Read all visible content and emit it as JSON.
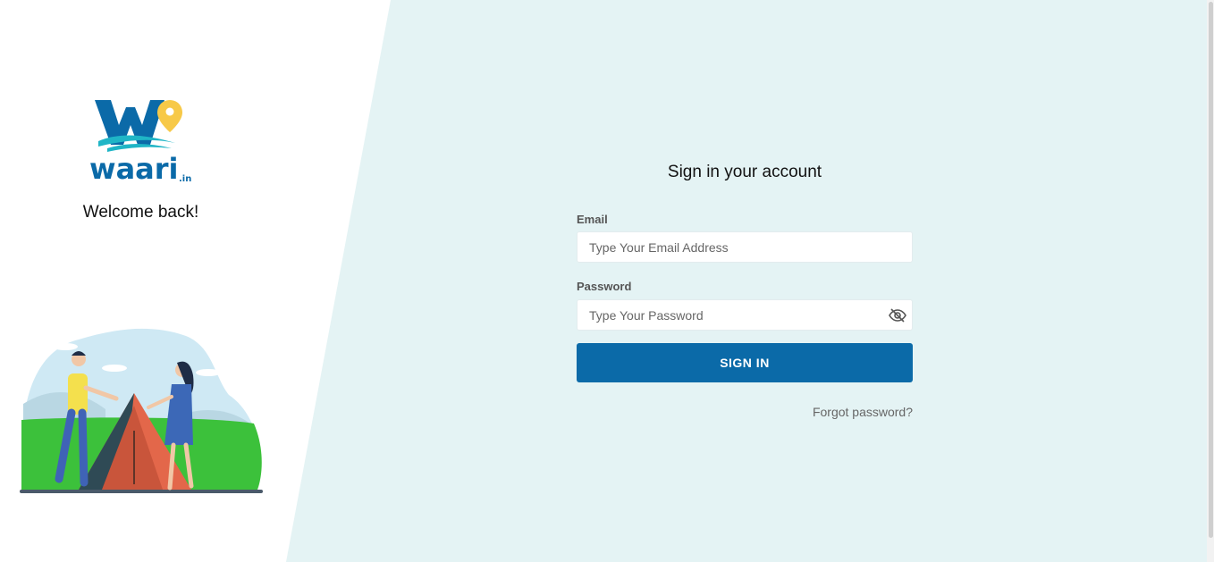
{
  "brand": {
    "logo_text": "waari",
    "logo_suffix": ".in",
    "welcome_text": "Welcome back!"
  },
  "form": {
    "title": "Sign in your account",
    "email_label": "Email",
    "email_placeholder": "Type Your Email Address",
    "password_label": "Password",
    "password_placeholder": "Type Your Password",
    "submit_label": "SIGN IN",
    "forgot_link": "Forgot password?"
  },
  "icons": {
    "password_toggle": "eye-slash-icon",
    "logo_pin": "location-pin-icon"
  },
  "colors": {
    "primary": "#0b6aa8",
    "panel_bg": "#e4f3f4",
    "logo_blue": "#0b6aa8",
    "logo_teal": "#1fb5c6",
    "logo_yellow": "#f7c948"
  }
}
